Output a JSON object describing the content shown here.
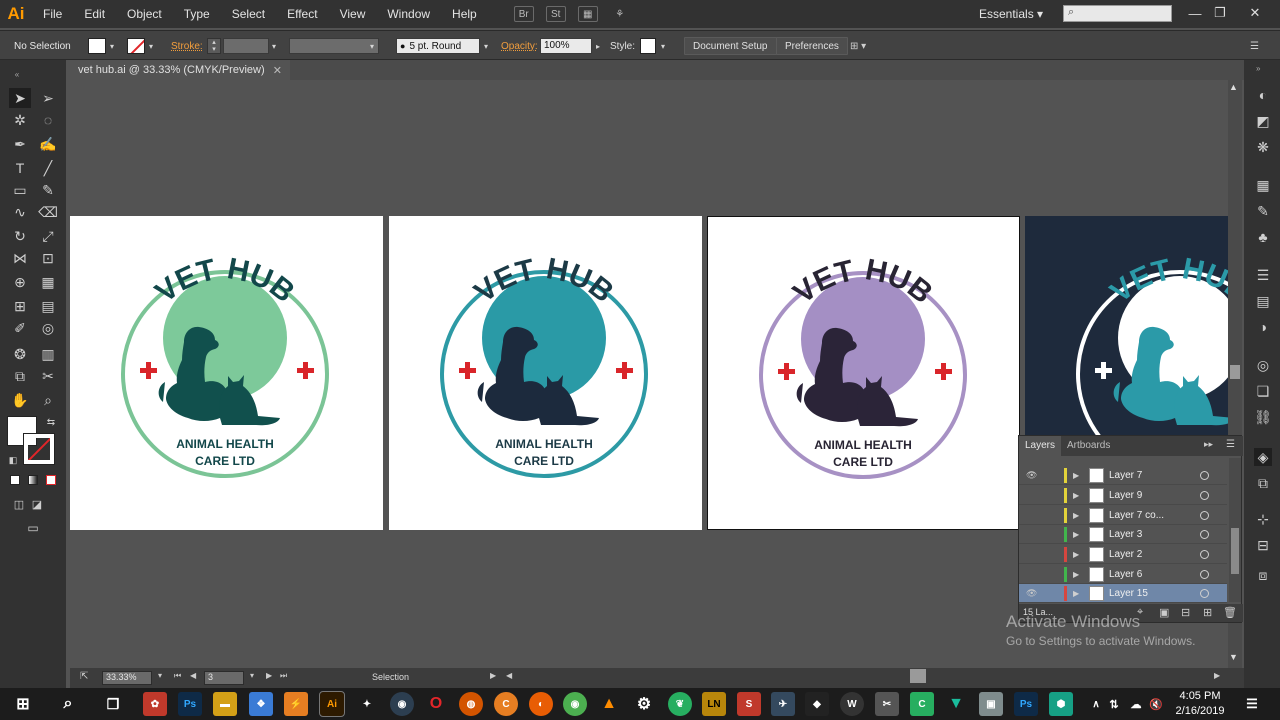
{
  "app": {
    "logo": "Ai",
    "workspace": "Essentials"
  },
  "menu": [
    "File",
    "Edit",
    "Object",
    "Type",
    "Select",
    "Effect",
    "View",
    "Window",
    "Help"
  ],
  "menubar_icons": {
    "bridge": "Br",
    "stock": "St"
  },
  "control": {
    "selection": "No Selection",
    "stroke_label": "Stroke:",
    "brush": "5 pt. Round",
    "opacity_label": "Opacity:",
    "opacity_value": "100%",
    "style_label": "Style:",
    "doc_setup": "Document Setup",
    "preferences": "Preferences"
  },
  "document": {
    "tab_title": "vet hub.ai @ 33.33% (CMYK/Preview)"
  },
  "logos": [
    {
      "title": "VET HUB",
      "line1": "ANIMAL HEALTH",
      "line2": "CARE LTD",
      "ring": "#7bc496",
      "circle": "#7dc99a",
      "pets": "#11504d",
      "text": "#12474a"
    },
    {
      "title": "VET HUB",
      "line1": "ANIMAL HEALTH",
      "line2": "CARE LTD",
      "ring": "#2d9aa5",
      "circle": "#2a9aa6",
      "pets": "#1c2a3d",
      "text": "#1c3a46"
    },
    {
      "title": "VET HUB",
      "line1": "ANIMAL HEALTH",
      "line2": "CARE LTD",
      "ring": "#a791c4",
      "circle": "#a48fc4",
      "pets": "#2b2438",
      "text": "#282433"
    },
    {
      "title": "VET HUB",
      "ring": "#ffffff",
      "circle": "#ffffff",
      "pets": "#2b9aa8",
      "text": "#2b9aa8"
    }
  ],
  "colors": {
    "cross": "#d9252a",
    "accent": "#ff9a00"
  },
  "layers": {
    "tabs": [
      "Layers",
      "Artboards"
    ],
    "items": [
      {
        "name": "Layer 7",
        "color": "#e3d33a"
      },
      {
        "name": "Layer 9",
        "color": "#e3d33a"
      },
      {
        "name": "Layer 7 co...",
        "color": "#e3d33a"
      },
      {
        "name": "Layer 3",
        "color": "#41b54c"
      },
      {
        "name": "Layer 2",
        "color": "#d6463f"
      },
      {
        "name": "Layer 6",
        "color": "#41b54c"
      },
      {
        "name": "Layer 15",
        "color": "#d6463f",
        "selected": true
      }
    ],
    "count": "15 La..."
  },
  "status": {
    "zoom": "33.33%",
    "page": "3",
    "tool": "Selection"
  },
  "watermark": {
    "line1": "Activate Windows",
    "line2": "Go to Settings to activate Windows."
  },
  "taskbar": {
    "time": "4:05 PM",
    "date": "2/16/2019",
    "icons": {
      "photoshop": "Ps",
      "illustrator": "Ai",
      "ln": "LN",
      "photoshop2": "Ps"
    }
  }
}
